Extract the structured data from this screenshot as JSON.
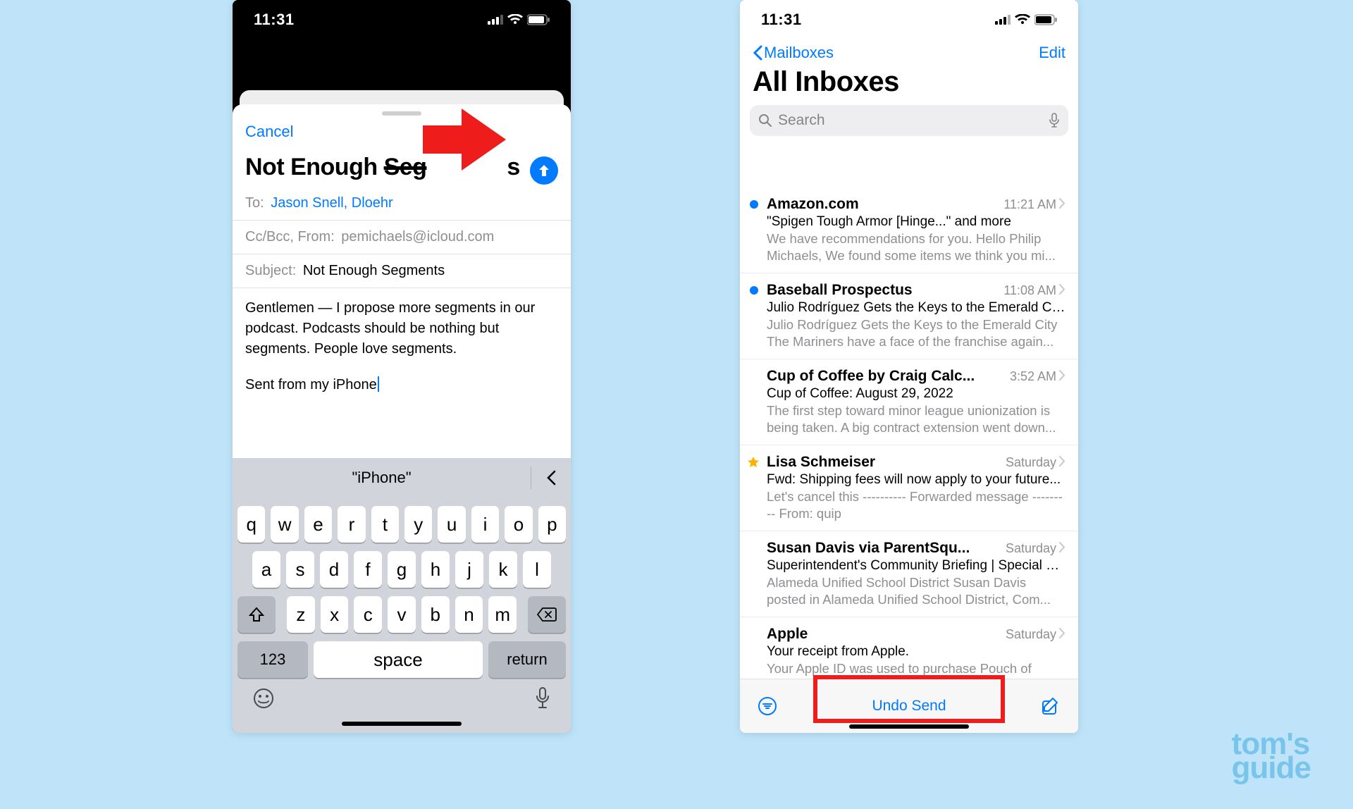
{
  "status_time": "11:31",
  "watermark_line1": "tom's",
  "watermark_line2": "guide",
  "left": {
    "cancel": "Cancel",
    "title_prefix": "Not Enough ",
    "title_strike": "Seg",
    "title_suffix": "s",
    "to_label": "To:",
    "to_value": "Jason Snell, Dloehr",
    "cc_label": "Cc/Bcc, From:",
    "cc_value": "pemichaels@icloud.com",
    "subject_label": "Subject:",
    "subject_value": "Not Enough Segments",
    "body_para": "Gentlemen — I propose more segments in our podcast. Podcasts should be nothing but segments. People love segments.",
    "signature": "Sent from my iPhone",
    "predict": "\"iPhone\"",
    "keys_r1": [
      "q",
      "w",
      "e",
      "r",
      "t",
      "y",
      "u",
      "i",
      "o",
      "p"
    ],
    "keys_r2": [
      "a",
      "s",
      "d",
      "f",
      "g",
      "h",
      "j",
      "k",
      "l"
    ],
    "keys_r3": [
      "z",
      "x",
      "c",
      "v",
      "b",
      "n",
      "m"
    ],
    "key_123": "123",
    "key_space": "space",
    "key_return": "return"
  },
  "right": {
    "back_label": "Mailboxes",
    "edit_label": "Edit",
    "title": "All Inboxes",
    "search_placeholder": "Search",
    "messages": [
      {
        "unread": true,
        "star": false,
        "sender": "Amazon.com",
        "time": "11:21 AM",
        "subject": "\"Spigen Tough Armor [Hinge...\" and more",
        "preview": "We have recommendations for you. Hello Philip Michaels, We found some items we think you mi..."
      },
      {
        "unread": true,
        "star": false,
        "sender": "Baseball Prospectus",
        "time": "11:08 AM",
        "subject": "Julio Rodríguez Gets the Keys to the Emerald Cit...",
        "preview": "Julio Rodríguez Gets the Keys to the Emerald City The Mariners have a face of the franchise again..."
      },
      {
        "unread": false,
        "star": false,
        "sender": "Cup of Coffee by Craig Calc...",
        "time": "3:52 AM",
        "subject": "Cup of Coffee: August 29, 2022",
        "preview": "The first step toward minor league unionization is being taken. A big contract extension went down..."
      },
      {
        "unread": false,
        "star": true,
        "sender": "Lisa Schmeiser",
        "time": "Saturday",
        "subject": "Fwd: Shipping fees will now apply to your future...",
        "preview": "Let's cancel this ---------- Forwarded message --------- From: quip <info@accounts.getquip.co..."
      },
      {
        "unread": false,
        "star": false,
        "sender": "Susan Davis via ParentSqu...",
        "time": "Saturday",
        "subject": "Superintendent's Community Briefing | Special E...",
        "preview": "Alameda Unified School District Susan Davis posted in Alameda Unified School District, Com..."
      },
      {
        "unread": false,
        "star": false,
        "sender": "Apple",
        "time": "Saturday",
        "subject": "Your receipt from Apple.",
        "preview": "Your Apple ID was used to purchase Pouch of"
      }
    ],
    "undo_label": "Undo Send"
  }
}
